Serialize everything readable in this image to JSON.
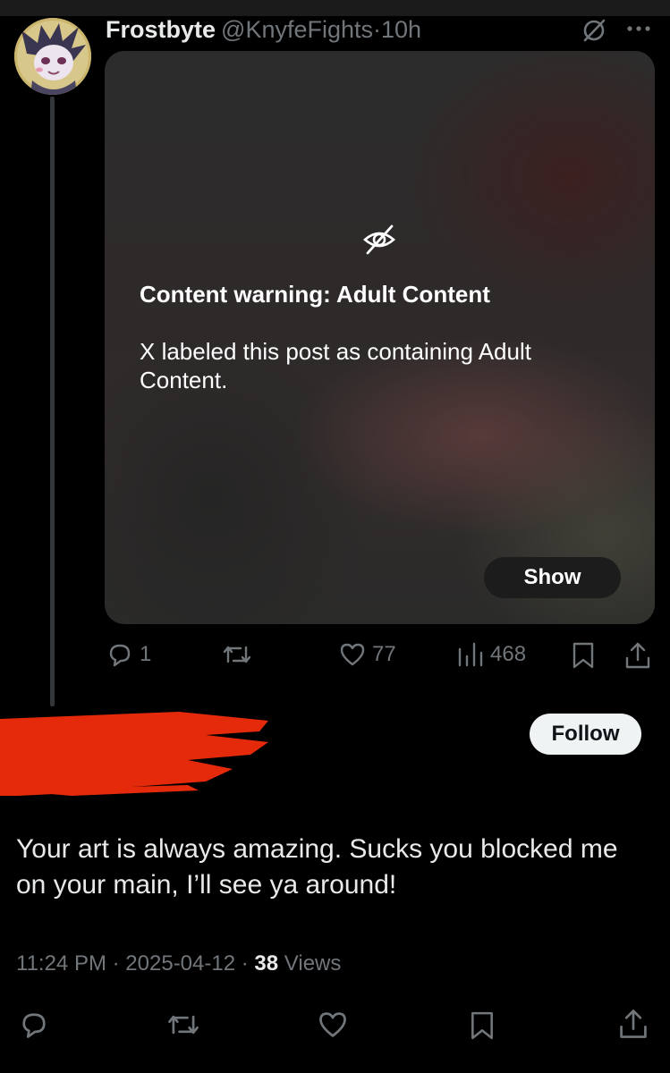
{
  "parent_post": {
    "display_name": "Frostbyte",
    "handle": "@KnyfeFights",
    "separator": "·",
    "time": "10h",
    "media": {
      "warning_title": "Content warning: Adult Content",
      "warning_text": "X labeled this post as containing Adult Content.",
      "show_label": "Show"
    },
    "actions": {
      "reply_count": "1",
      "repost_count": "",
      "like_count": "77",
      "views_count": "468"
    }
  },
  "reply_post": {
    "follow_label": "Follow",
    "text": "Your art is always amazing. Sucks you blocked me on your main, I’ll see ya around!",
    "time": "11:24 PM",
    "date": "2025-04-12",
    "separator": "·",
    "views_count": "38",
    "views_label": "Views"
  },
  "colors": {
    "background": "#000000",
    "primary_text": "#e7e9ea",
    "secondary_text": "#71767b",
    "redaction": "#e52a0b"
  },
  "icons": [
    "hidden-content-icon",
    "more-icon",
    "reply-icon",
    "repost-icon",
    "like-icon",
    "views-icon",
    "bookmark-icon",
    "share-icon"
  ]
}
